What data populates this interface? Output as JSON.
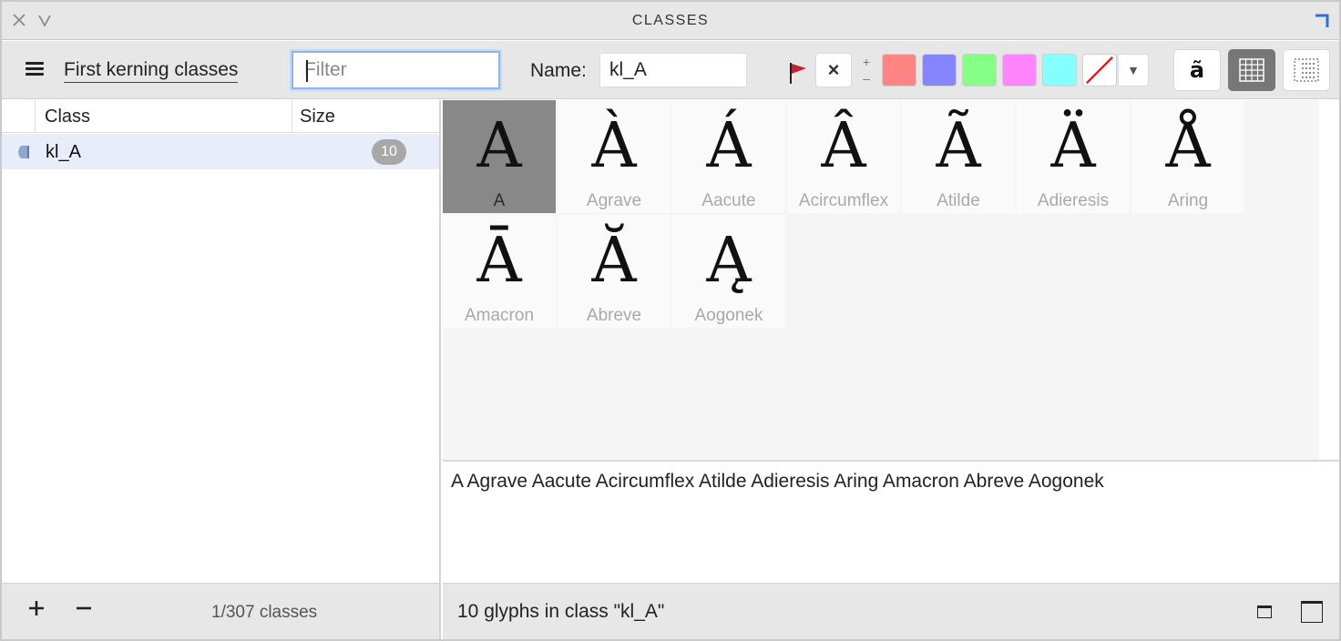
{
  "titlebar": {
    "title": "CLASSES",
    "close_icon": "close-icon",
    "collapse_icon": "chevron-down-icon"
  },
  "toolbar": {
    "menu_icon": "hamburger-icon",
    "mode_label": "First kerning classes",
    "filter_placeholder": "Filter",
    "filter_value": "",
    "name_label": "Name:",
    "name_value": "kl_A",
    "flag_color": "#c8202a",
    "clear_label": "×",
    "plus_label": "+",
    "minus_label": "–",
    "swatches": [
      {
        "name": "red",
        "color": "#ff8585"
      },
      {
        "name": "blue",
        "color": "#8585ff"
      },
      {
        "name": "green",
        "color": "#85ff85"
      },
      {
        "name": "pink",
        "color": "#ff85ff"
      },
      {
        "name": "cyan",
        "color": "#85ffff"
      }
    ],
    "dropdown_label": "▼",
    "glyph_view_label": "ã"
  },
  "list": {
    "col_class": "Class",
    "col_size": "Size",
    "rows": [
      {
        "name": "kl_A",
        "size": "10"
      }
    ]
  },
  "glyphs": [
    {
      "char": "A",
      "name": "A",
      "selected": true
    },
    {
      "char": "À",
      "name": "Agrave"
    },
    {
      "char": "Á",
      "name": "Aacute"
    },
    {
      "char": "Â",
      "name": "Acircumflex"
    },
    {
      "char": "Ã",
      "name": "Atilde"
    },
    {
      "char": "Ä",
      "name": "Adieresis"
    },
    {
      "char": "Å",
      "name": "Aring"
    },
    {
      "char": "Ā",
      "name": "Amacron"
    },
    {
      "char": "Ă",
      "name": "Abreve"
    },
    {
      "char": "Ą",
      "name": "Aogonek"
    }
  ],
  "glyph_text": "A Agrave Aacute Acircumflex Atilde Adieresis Aring Amacron Abreve Aogonek",
  "footer_left": {
    "count": "1/307 classes"
  },
  "footer_right": {
    "status": "10 glyphs in class \"kl_A\""
  },
  "colors": {
    "selection": "#e7eefa",
    "selected_glyph": "#888888",
    "accent": "#2f6fd6"
  }
}
